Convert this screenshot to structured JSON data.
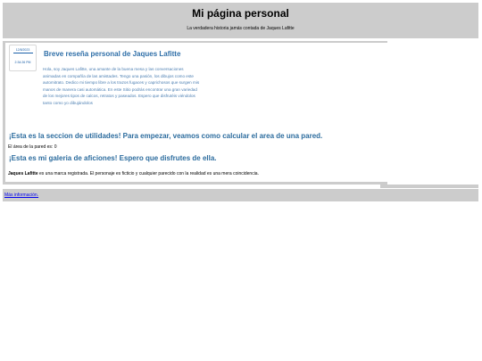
{
  "header": {
    "title": "Mi página personal",
    "subtitle": "La verdadera historia jamás contada de Jaques Lafitte"
  },
  "clock": {
    "date": "12/8/2023",
    "time": "2:34:26 PM"
  },
  "profile": {
    "title": "Breve reseña personal de Jaques Lafitte",
    "text": "Hola, soy Jaques Lafitte, una amante de la buena mesa y las conversaciones animadas en compañía de las amistades. Tengo una pasión, los dibujos como este automitrato. Dedico mi tiempo libre a los trazos fugaces y caprichosos que surgen mis manos de manera casi automática. En este Sitio podrás encontrar una gran variedad de los mejores tipos de calcos, retratos y paseados. Espero que disfrutéis viéndolos tanto como yo dibujándolos"
  },
  "utilities": {
    "title": "¡Esta es la seccion de utilidades! Para empezar, veamos como calcular el area de una pared.",
    "wall_area": "El área de la pared es: 0"
  },
  "gallery": {
    "title": "¡Esta es mi galeria de aficiones! Espero que disfrutes de ella."
  },
  "disclaimer": {
    "name": "Jaques Lafitte",
    "text": " es una marca registrada. El personaje es ficticio y cualquier parecido con la realidad es una mera coincidencia."
  },
  "footer": {
    "link": "Más información."
  }
}
